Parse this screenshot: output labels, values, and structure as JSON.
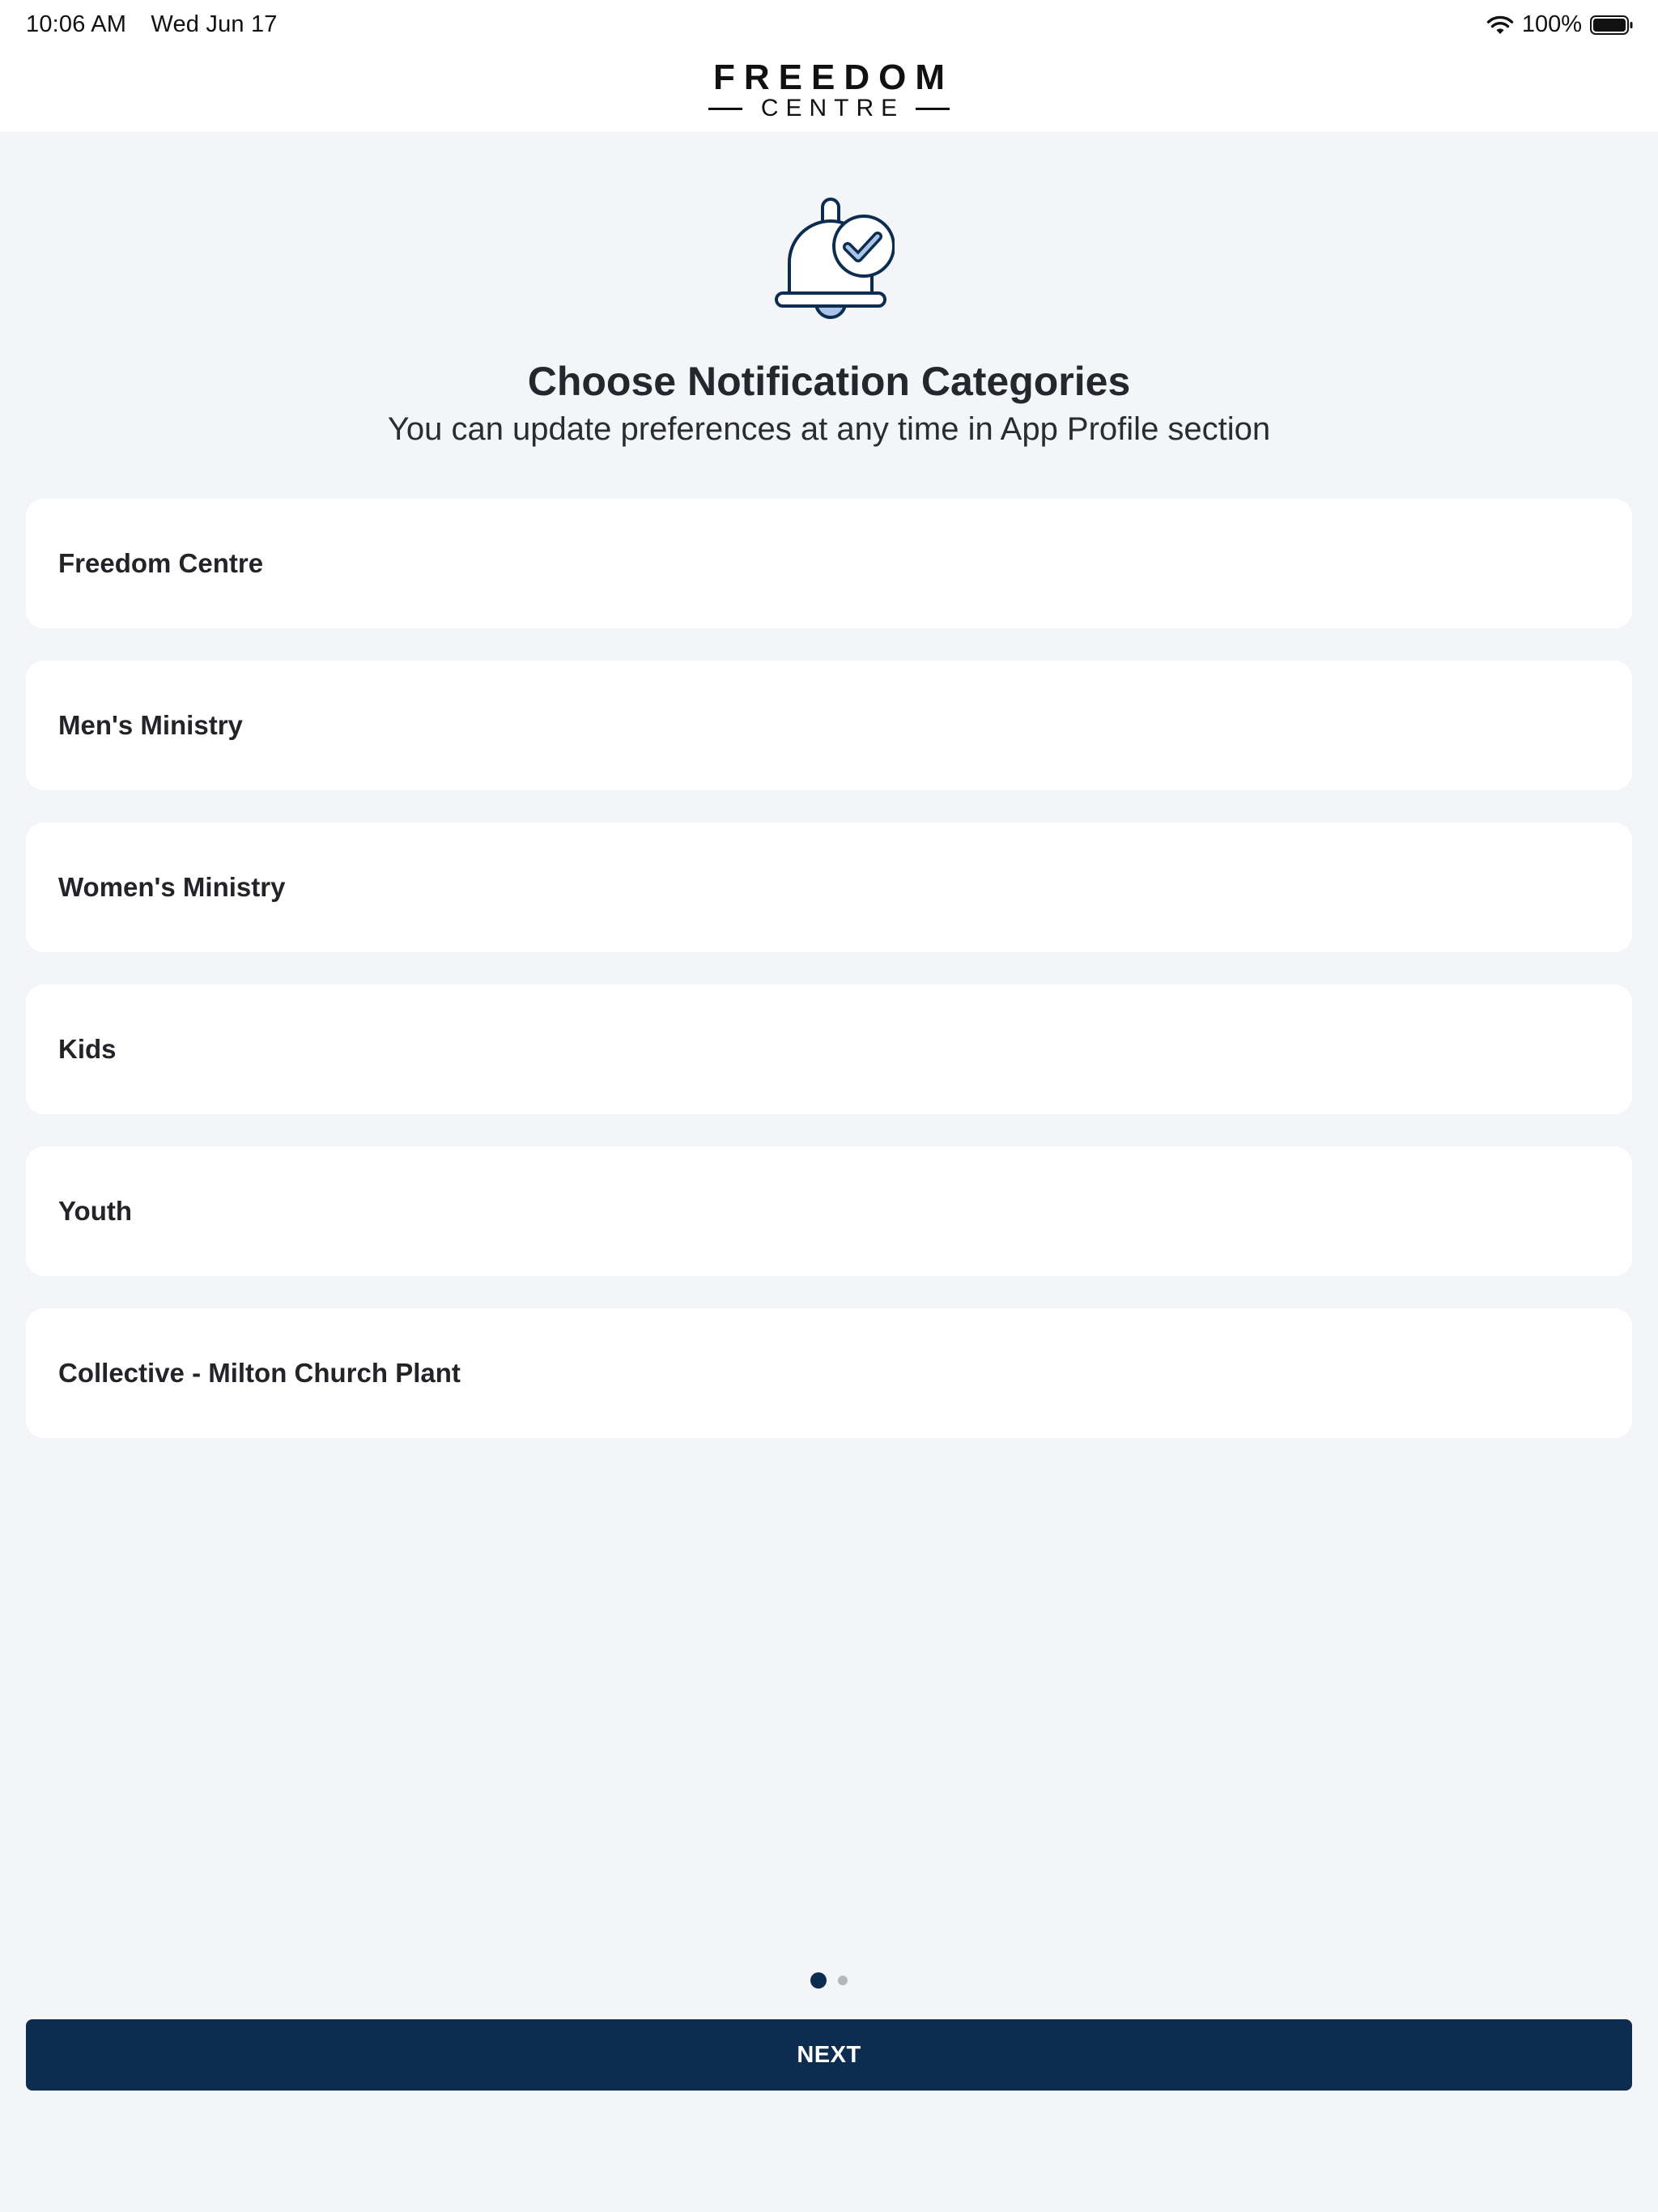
{
  "status_bar": {
    "time": "10:06 AM",
    "date": "Wed Jun 17",
    "battery_percent": "100%",
    "icons": [
      "wifi-icon",
      "battery-icon"
    ]
  },
  "header": {
    "logo_line1": "FREEDOM",
    "logo_line2": "CENTRE"
  },
  "hero": {
    "icon": "bell-check-icon",
    "title": "Choose Notification Categories",
    "subtitle": "You can update preferences at any time in App Profile section"
  },
  "categories": [
    {
      "label": "Freedom Centre"
    },
    {
      "label": "Men's Ministry"
    },
    {
      "label": "Women's Ministry"
    },
    {
      "label": "Kids"
    },
    {
      "label": "Youth"
    },
    {
      "label": "Collective - Milton Church Plant"
    }
  ],
  "pager": {
    "current_page": 1,
    "total_pages": 2
  },
  "footer": {
    "next_label": "NEXT"
  },
  "colors": {
    "primary": "#0c2d4f",
    "background": "#f4f5f9",
    "card": "#ffffff",
    "icon_accent": "#a9c4e6"
  }
}
